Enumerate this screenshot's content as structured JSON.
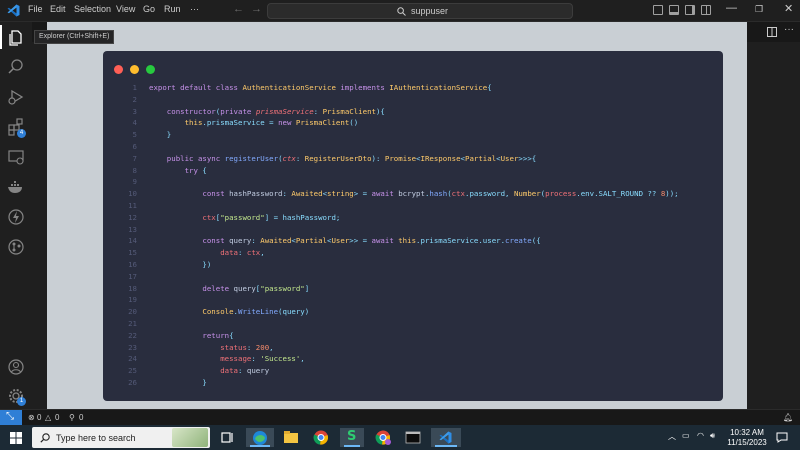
{
  "menu": [
    "File",
    "Edit",
    "Selection",
    "View",
    "Go",
    "Run",
    "···"
  ],
  "search": {
    "label": "suppuser"
  },
  "tooltip": "Explorer (Ctrl+Shift+E)",
  "activity_badges": {
    "extensions": "4",
    "accounts": "1"
  },
  "status": {
    "problems": "0",
    "warnings": "0",
    "ports": "0"
  },
  "taskbar": {
    "search_placeholder": "Type here to search"
  },
  "clock": {
    "time": "10:32 AM",
    "date": "11/15/2023"
  },
  "code_lines": [
    {
      "n": "1",
      "tokens": [
        {
          "t": "export default class ",
          "c": "k"
        },
        {
          "t": "AuthenticationService ",
          "c": "t"
        },
        {
          "t": "implements ",
          "c": "k"
        },
        {
          "t": "IAuthenticationService",
          "c": "t"
        },
        {
          "t": "{",
          "c": "p"
        }
      ]
    },
    {
      "n": "2",
      "tokens": []
    },
    {
      "n": "3",
      "tokens": [
        {
          "t": "    constructor",
          "c": "k"
        },
        {
          "t": "(",
          "c": "p"
        },
        {
          "t": "private ",
          "c": "k"
        },
        {
          "t": "prismaService",
          "c": "i"
        },
        {
          "t": ": ",
          "c": "p"
        },
        {
          "t": "PrismaClient",
          "c": "t"
        },
        {
          "t": "){",
          "c": "p"
        }
      ]
    },
    {
      "n": "4",
      "tokens": [
        {
          "t": "        this",
          "c": "t"
        },
        {
          "t": ".prismaService = ",
          "c": "p"
        },
        {
          "t": "new ",
          "c": "k"
        },
        {
          "t": "PrismaClient",
          "c": "t"
        },
        {
          "t": "()",
          "c": "p"
        }
      ]
    },
    {
      "n": "5",
      "tokens": [
        {
          "t": "    }",
          "c": "p"
        }
      ]
    },
    {
      "n": "6",
      "tokens": []
    },
    {
      "n": "7",
      "tokens": [
        {
          "t": "    public async ",
          "c": "k"
        },
        {
          "t": "registerUser",
          "c": "f"
        },
        {
          "t": "(",
          "c": "p"
        },
        {
          "t": "ctx",
          "c": "i"
        },
        {
          "t": ": ",
          "c": "p"
        },
        {
          "t": "RegisterUserDto",
          "c": "t"
        },
        {
          "t": "): ",
          "c": "p"
        },
        {
          "t": "Promise",
          "c": "t"
        },
        {
          "t": "<",
          "c": "p"
        },
        {
          "t": "IResponse",
          "c": "t"
        },
        {
          "t": "<",
          "c": "p"
        },
        {
          "t": "Partial",
          "c": "t"
        },
        {
          "t": "<",
          "c": "p"
        },
        {
          "t": "User",
          "c": "t"
        },
        {
          "t": ">>>{",
          "c": "p"
        }
      ]
    },
    {
      "n": "8",
      "tokens": [
        {
          "t": "        try ",
          "c": "k"
        },
        {
          "t": "{",
          "c": "p"
        }
      ]
    },
    {
      "n": "9",
      "tokens": []
    },
    {
      "n": "10",
      "tokens": [
        {
          "t": "            const ",
          "c": "k"
        },
        {
          "t": "hashPassword",
          "c": ""
        },
        {
          "t": ": ",
          "c": "p"
        },
        {
          "t": "Awaited",
          "c": "t"
        },
        {
          "t": "<",
          "c": "p"
        },
        {
          "t": "string",
          "c": "t"
        },
        {
          "t": "> = ",
          "c": "p"
        },
        {
          "t": "await ",
          "c": "k"
        },
        {
          "t": "bcrypt",
          "c": ""
        },
        {
          "t": ".",
          "c": "p"
        },
        {
          "t": "hash",
          "c": "f"
        },
        {
          "t": "(",
          "c": "p"
        },
        {
          "t": "ctx",
          "c": "v"
        },
        {
          "t": ".password, ",
          "c": "p"
        },
        {
          "t": "Number",
          "c": "t"
        },
        {
          "t": "(",
          "c": "p"
        },
        {
          "t": "process",
          "c": "v"
        },
        {
          "t": ".env.SALT_ROUND ?? ",
          "c": "p"
        },
        {
          "t": "8",
          "c": "n"
        },
        {
          "t": "));",
          "c": "p"
        }
      ]
    },
    {
      "n": "11",
      "tokens": []
    },
    {
      "n": "12",
      "tokens": [
        {
          "t": "            ctx",
          "c": "v"
        },
        {
          "t": "[",
          "c": "p"
        },
        {
          "t": "\"password\"",
          "c": "s"
        },
        {
          "t": "] = hashPassword;",
          "c": "p"
        }
      ]
    },
    {
      "n": "13",
      "tokens": []
    },
    {
      "n": "14",
      "tokens": [
        {
          "t": "            const ",
          "c": "k"
        },
        {
          "t": "query",
          "c": ""
        },
        {
          "t": ": ",
          "c": "p"
        },
        {
          "t": "Awaited",
          "c": "t"
        },
        {
          "t": "<",
          "c": "p"
        },
        {
          "t": "Partial",
          "c": "t"
        },
        {
          "t": "<",
          "c": "p"
        },
        {
          "t": "User",
          "c": "t"
        },
        {
          "t": ">> = ",
          "c": "p"
        },
        {
          "t": "await ",
          "c": "k"
        },
        {
          "t": "this",
          "c": "t"
        },
        {
          "t": ".prismaService.user.",
          "c": "p"
        },
        {
          "t": "create",
          "c": "f"
        },
        {
          "t": "({",
          "c": "p"
        }
      ]
    },
    {
      "n": "15",
      "tokens": [
        {
          "t": "                data",
          "c": "v"
        },
        {
          "t": ": ",
          "c": "p"
        },
        {
          "t": "ctx",
          "c": "v"
        },
        {
          "t": ",",
          "c": "p"
        }
      ]
    },
    {
      "n": "16",
      "tokens": [
        {
          "t": "            })",
          "c": "p"
        }
      ]
    },
    {
      "n": "17",
      "tokens": []
    },
    {
      "n": "18",
      "tokens": [
        {
          "t": "            delete ",
          "c": "k"
        },
        {
          "t": "query",
          "c": ""
        },
        {
          "t": "[",
          "c": "p"
        },
        {
          "t": "\"password\"",
          "c": "s"
        },
        {
          "t": "]",
          "c": "p"
        }
      ]
    },
    {
      "n": "19",
      "tokens": []
    },
    {
      "n": "20",
      "tokens": [
        {
          "t": "            Console",
          "c": "t"
        },
        {
          "t": ".",
          "c": "p"
        },
        {
          "t": "WriteLine",
          "c": "f"
        },
        {
          "t": "(query)",
          "c": "p"
        }
      ]
    },
    {
      "n": "21",
      "tokens": []
    },
    {
      "n": "22",
      "tokens": [
        {
          "t": "            return",
          "c": "k"
        },
        {
          "t": "{",
          "c": "p"
        }
      ]
    },
    {
      "n": "23",
      "tokens": [
        {
          "t": "                status",
          "c": "v"
        },
        {
          "t": ": ",
          "c": "p"
        },
        {
          "t": "200",
          "c": "n"
        },
        {
          "t": ",",
          "c": "p"
        }
      ]
    },
    {
      "n": "24",
      "tokens": [
        {
          "t": "                message",
          "c": "v"
        },
        {
          "t": ": ",
          "c": "p"
        },
        {
          "t": "'Success'",
          "c": "s"
        },
        {
          "t": ",",
          "c": "p"
        }
      ]
    },
    {
      "n": "25",
      "tokens": [
        {
          "t": "                data",
          "c": "v"
        },
        {
          "t": ": ",
          "c": "p"
        },
        {
          "t": "query",
          "c": ""
        }
      ]
    },
    {
      "n": "26",
      "tokens": [
        {
          "t": "            }",
          "c": "p"
        }
      ]
    }
  ],
  "colors": {
    "accent": "#2f7fd6",
    "code_bg": "#292d3e",
    "canvas_bg": "#c9cfd4",
    "traffic_red": "#ff5f56",
    "traffic_yellow": "#ffbd2e",
    "traffic_green": "#27c93f"
  }
}
